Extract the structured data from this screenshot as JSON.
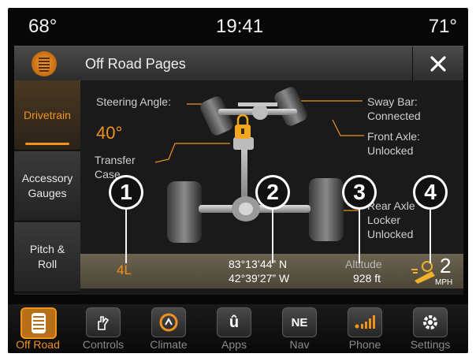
{
  "status": {
    "temp_left": "68°",
    "time": "19:41",
    "temp_right": "71°"
  },
  "titlebar": {
    "title": "Off Road Pages",
    "close_label": "✕"
  },
  "sidebar": {
    "items": [
      {
        "label": "Drivetrain",
        "active": true
      },
      {
        "label": "Accessory Gauges",
        "active": false
      },
      {
        "label": "Pitch & Roll",
        "active": false
      }
    ]
  },
  "vehicle": {
    "steering_label": "Steering Angle:",
    "steering_value": "40°",
    "transfer_label": "Transfer Case",
    "sway_bar_label": "Sway Bar:",
    "sway_bar_value": "Connected",
    "front_axle_label": "Front Axle:",
    "front_axle_value": "Unlocked",
    "rear_axle_label": "Rear Axle Locker",
    "rear_axle_value": "Unlocked"
  },
  "readout": {
    "transfer_mode": "4L",
    "lon": "83°13’44” N",
    "lat": "42°39’27” W",
    "altitude_label": "Altitude",
    "altitude_value": "928 ft",
    "speed_value": "2",
    "speed_unit": "MPH"
  },
  "callouts": [
    "1",
    "2",
    "3",
    "4"
  ],
  "nav": {
    "items": [
      {
        "label": "Off Road",
        "icon": "tire-tread-icon",
        "active": true
      },
      {
        "label": "Controls",
        "icon": "hand-controls-icon",
        "active": false
      },
      {
        "label": "Climate",
        "icon": "climate-icon",
        "active": false
      },
      {
        "label": "Apps",
        "icon": "apps-icon",
        "active": false
      },
      {
        "label": "Nav",
        "icon": "compass-icon",
        "active": false,
        "badge": "NE"
      },
      {
        "label": "Phone",
        "icon": "phone-icon",
        "active": false
      },
      {
        "label": "Settings",
        "icon": "gear-icon",
        "active": false
      }
    ]
  },
  "colors": {
    "accent": "#f0921e",
    "background": "#070707",
    "readout_bar": "#5b5543"
  }
}
